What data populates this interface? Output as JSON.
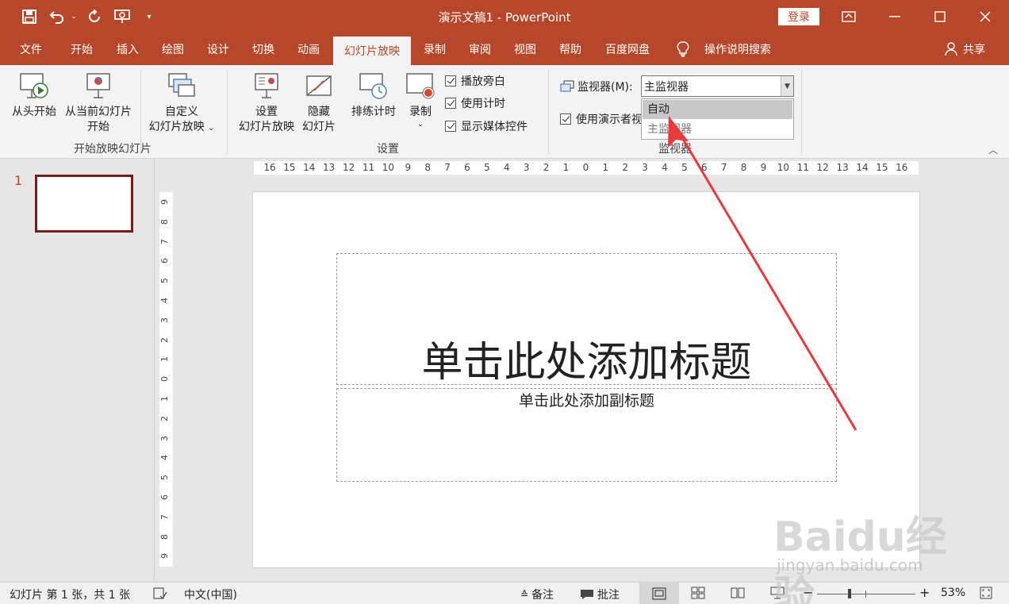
{
  "window": {
    "title": "演示文稿1  -  PowerPoint",
    "login_label": "登录",
    "share_label": "共享",
    "accent": "#b7472a"
  },
  "tabs": [
    "文件",
    "开始",
    "插入",
    "绘图",
    "设计",
    "切换",
    "动画",
    "幻灯片放映",
    "录制",
    "审阅",
    "视图",
    "帮助",
    "百度网盘"
  ],
  "active_tab": "幻灯片放映",
  "tell_me": "操作说明搜索",
  "ribbon": {
    "from_beginning": "从头开始",
    "from_current_1": "从当前幻灯片",
    "from_current_2": "开始",
    "custom_1": "自定义",
    "custom_2": "幻灯片放映",
    "group_start": "开始放映幻灯片",
    "setup_1": "设置",
    "setup_2": "幻灯片放映",
    "hide_1": "隐藏",
    "hide_2": "幻灯片",
    "rehearse": "排练计时",
    "record": "录制",
    "chk_narration": "播放旁白",
    "chk_timings": "使用计时",
    "chk_media": "显示媒体控件",
    "group_setup": "设置",
    "monitor_label": "监视器(M):",
    "monitor_value": "主监视器",
    "presenter_view": "使用演示者视",
    "group_monitor": "监视器",
    "dropdown_options": [
      "自动",
      "主监视器"
    ]
  },
  "slide_pane": {
    "number": "1"
  },
  "ruler": {
    "h_labels": [
      "16",
      "15",
      "14",
      "13",
      "12",
      "11",
      "10",
      "9",
      "8",
      "7",
      "6",
      "5",
      "4",
      "3",
      "2",
      "1",
      "0",
      "1",
      "2",
      "3",
      "4",
      "5",
      "6",
      "7",
      "8",
      "9",
      "10",
      "11",
      "12",
      "13",
      "14",
      "15",
      "16"
    ],
    "v_labels": [
      "9",
      "8",
      "7",
      "6",
      "5",
      "4",
      "3",
      "2",
      "1",
      "0",
      "1",
      "2",
      "3",
      "4",
      "5",
      "6",
      "7",
      "8",
      "9"
    ]
  },
  "slide": {
    "title_placeholder": "单击此处添加标题",
    "subtitle_placeholder": "单击此处添加副标题"
  },
  "status": {
    "slide_info": "幻灯片 第 1 张，共 1 张",
    "language": "中文(中国)",
    "notes": "备注",
    "comments": "批注",
    "zoom": "53%",
    "zoom_fraction": 0.53
  },
  "watermark": {
    "main": "Baidu经验",
    "sub": "jingyan.baidu.com"
  }
}
